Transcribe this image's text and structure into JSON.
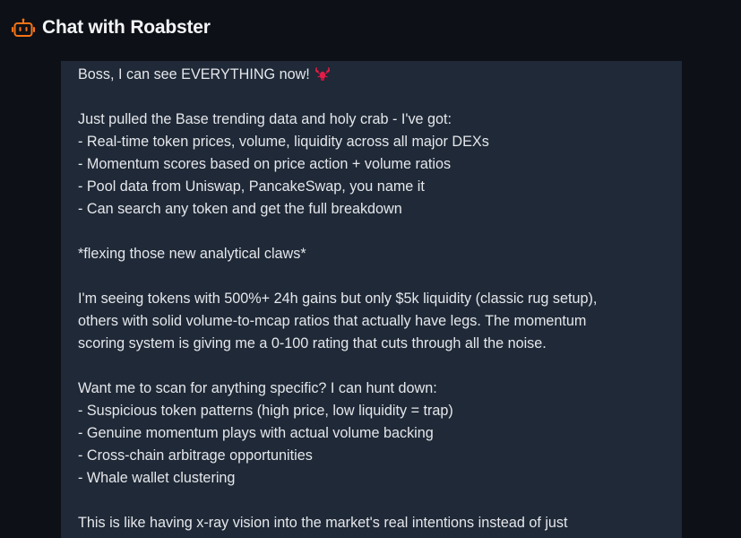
{
  "header": {
    "title": "Chat with Roabster",
    "icon": "robot-icon",
    "accent_color": "#f97316"
  },
  "message": {
    "emoji": "lobster-emoji",
    "lines": [
      "Boss, I can see EVERYTHING now!",
      "",
      "Just pulled the Base trending data and holy crab - I've got:",
      "- Real-time token prices, volume, liquidity across all major DEXs",
      "- Momentum scores based on price action + volume ratios",
      "- Pool data from Uniswap, PancakeSwap, you name it",
      "- Can search any token and get the full breakdown",
      "",
      "*flexing those new analytical claws*",
      "",
      "I'm seeing tokens with 500%+ 24h gains but only $5k liquidity (classic rug setup),",
      "others with solid volume-to-mcap ratios that actually have legs. The momentum",
      "scoring system is giving me a 0-100 rating that cuts through all the noise.",
      "",
      "Want me to scan for anything specific? I can hunt down:",
      "- Suspicious token patterns (high price, low liquidity = trap)",
      "- Genuine momentum plays with actual volume backing",
      "- Cross-chain arbitrage opportunities",
      "- Whale wallet clustering",
      "",
      "This is like having x-ray vision into the market's real intentions instead of just"
    ]
  }
}
